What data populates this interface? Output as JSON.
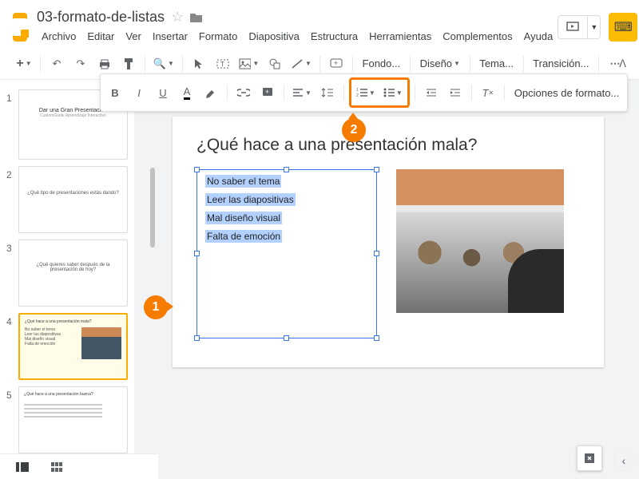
{
  "doc": {
    "title": "03-formato-de-listas"
  },
  "menu": {
    "file": "Archivo",
    "edit": "Editar",
    "view": "Ver",
    "insert": "Insertar",
    "format": "Formato",
    "slide": "Diapositiva",
    "arrange": "Estructura",
    "tools": "Herramientas",
    "addons": "Complementos",
    "help": "Ayuda"
  },
  "toolbar": {
    "background": "Fondo...",
    "layout": "Diseño",
    "theme": "Tema...",
    "transition": "Transición...",
    "format_options": "Opciones de formato..."
  },
  "slide": {
    "title": "¿Qué hace a una presentación mala?",
    "items": [
      "No saber el tema",
      "Leer las diapositivas",
      "Mal diseño visual",
      "Falta de emoción"
    ]
  },
  "thumbs": {
    "s1_title": "Dar una Gran Presentación",
    "s1_sub": "CustomGuide Aprendizaje Interactivo",
    "s2": "¿Qué tipo de presentaciones estás dando?",
    "s3": "¿Qué quieres saber después de la presentación de hoy?",
    "s4_title": "¿Qué hace a una presentación mala?",
    "s5_title": "¿Qué hace a una presentación buena?"
  },
  "callouts": {
    "one": "1",
    "two": "2"
  }
}
